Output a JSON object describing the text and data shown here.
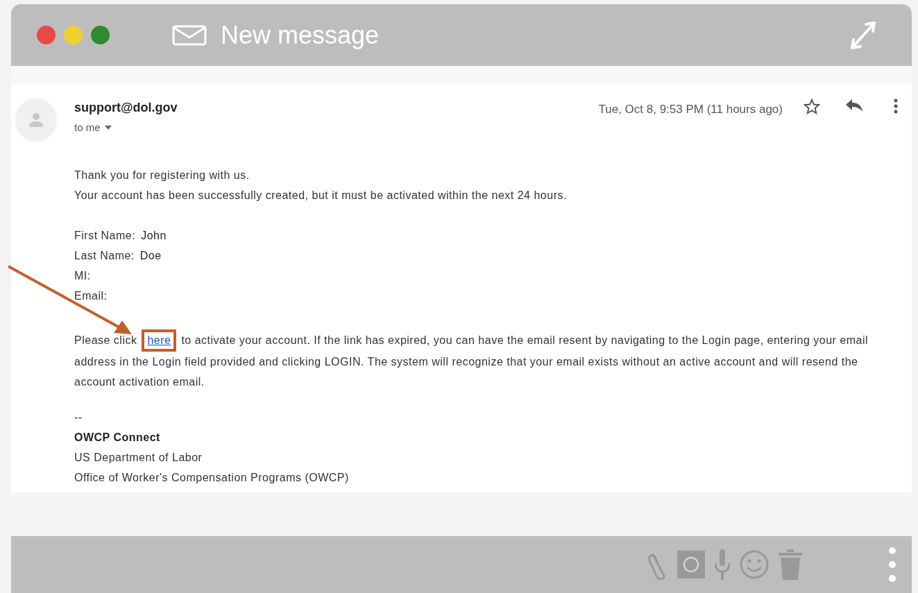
{
  "window": {
    "title": "New message",
    "traffic_lights": [
      {
        "color": "#e84848"
      },
      {
        "color": "#f0d030"
      },
      {
        "color": "#2e8b2e"
      }
    ]
  },
  "email": {
    "sender": "support@dol.gov",
    "recipient": "to me",
    "date": "Tue, Oct 8, 9:53 PM (11 hours ago)",
    "starred": false,
    "intro": [
      "Thank you for registering with us.",
      "Your account has been successfully created, but it must be activated within the next 24 hours."
    ],
    "fields": [
      {
        "label": "First Name:",
        "value": "John"
      },
      {
        "label": "Last Name:",
        "value": "Doe"
      },
      {
        "label": "MI:"
      },
      {
        "label": "Email:"
      }
    ],
    "paragraph": {
      "before": "Please click ",
      "link": "here",
      "after": " to activate your account. If the link has expired, you can have the email resent by navigating to the Login page, entering your email address in the Login field provided and clicking LOGIN. The system will recognize that your email exists without an active account and will resend the account activation email."
    },
    "signature": [
      "--",
      "OWCP Connect",
      "US Department of Labor",
      "Office of Worker's Compensation Programs (OWCP)"
    ]
  }
}
